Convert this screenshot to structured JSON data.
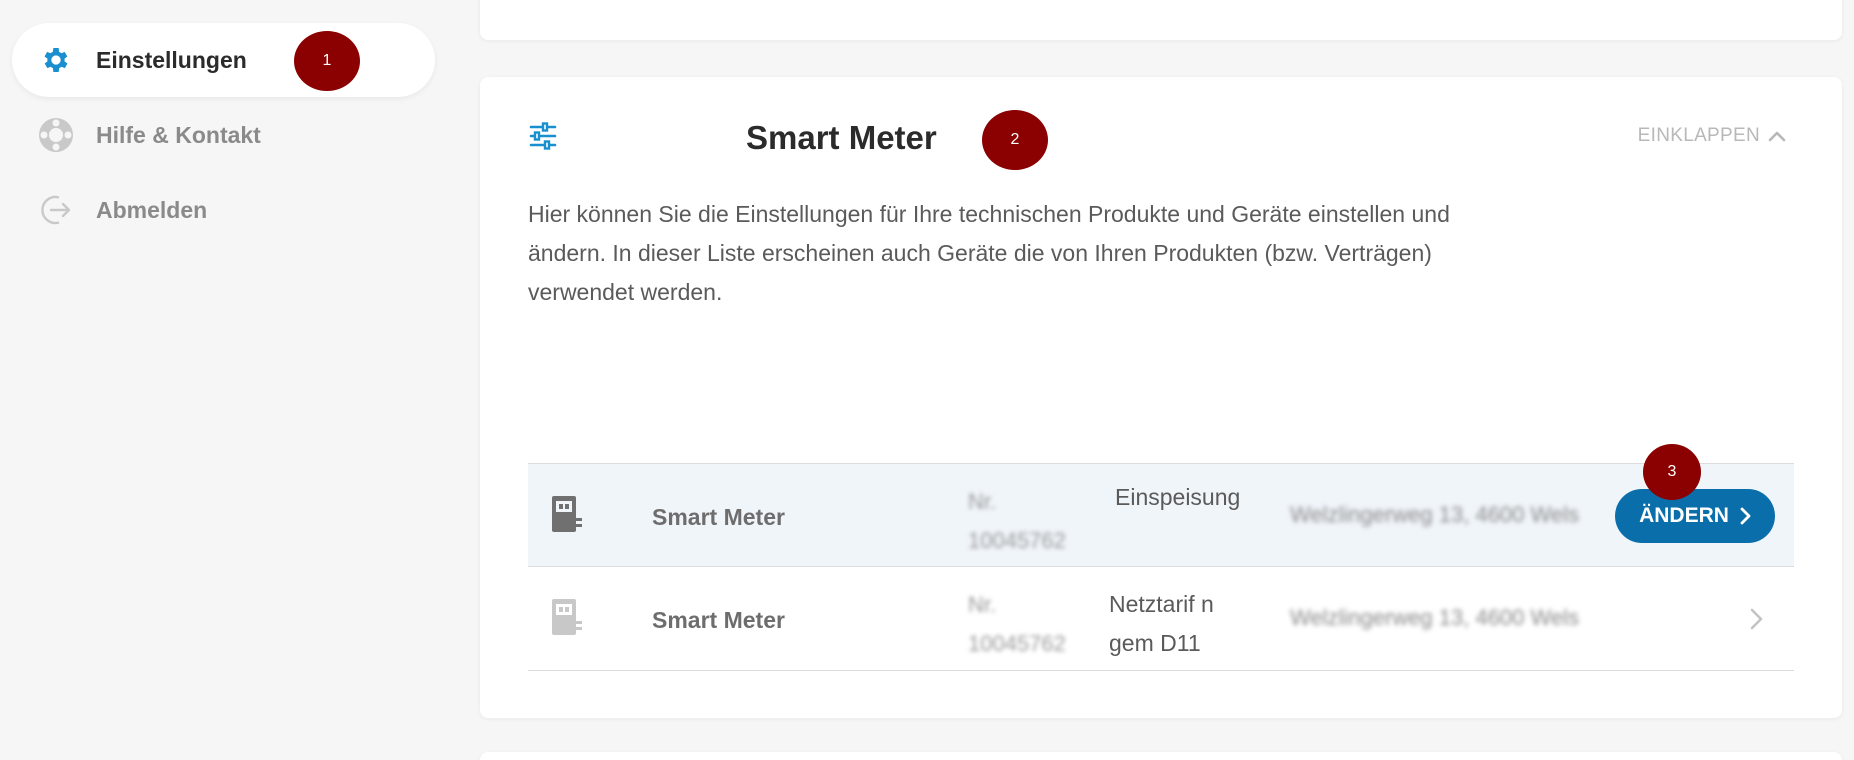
{
  "sidebar": {
    "items": [
      {
        "label": "Einstellungen",
        "icon": "gear-icon",
        "active": true
      },
      {
        "label": "Hilfe & Kontakt",
        "icon": "lifebuoy-icon",
        "active": false
      },
      {
        "label": "Abmelden",
        "icon": "logout-icon",
        "active": false
      }
    ]
  },
  "markers": [
    "1",
    "2",
    "3"
  ],
  "card": {
    "title": "Smart Meter",
    "collapse_label": "EINKLAPPEN",
    "description": "Hier können Sie die Einstellungen für Ihre technischen Produkte und Geräte einstellen und ändern. In dieser Liste erscheinen auch Geräte die von Ihren Produkten (bzw. Verträgen) verwendet werden."
  },
  "devices": [
    {
      "name": "Smart Meter",
      "nr": "Nr. 10045762",
      "type": "Einspeisung",
      "address": "Welzlingerweg 13, 4600 Wels",
      "action": "ÄNDERN"
    },
    {
      "name": "Smart Meter",
      "nr": "Nr. 10045762",
      "type": "Netztarif n gem D11",
      "address": "Welzlingerweg 13, 4600 Wels"
    }
  ],
  "colors": {
    "accent": "#0a6eaa",
    "marker": "#8b0000",
    "icon_blue": "#1a8fd0"
  }
}
